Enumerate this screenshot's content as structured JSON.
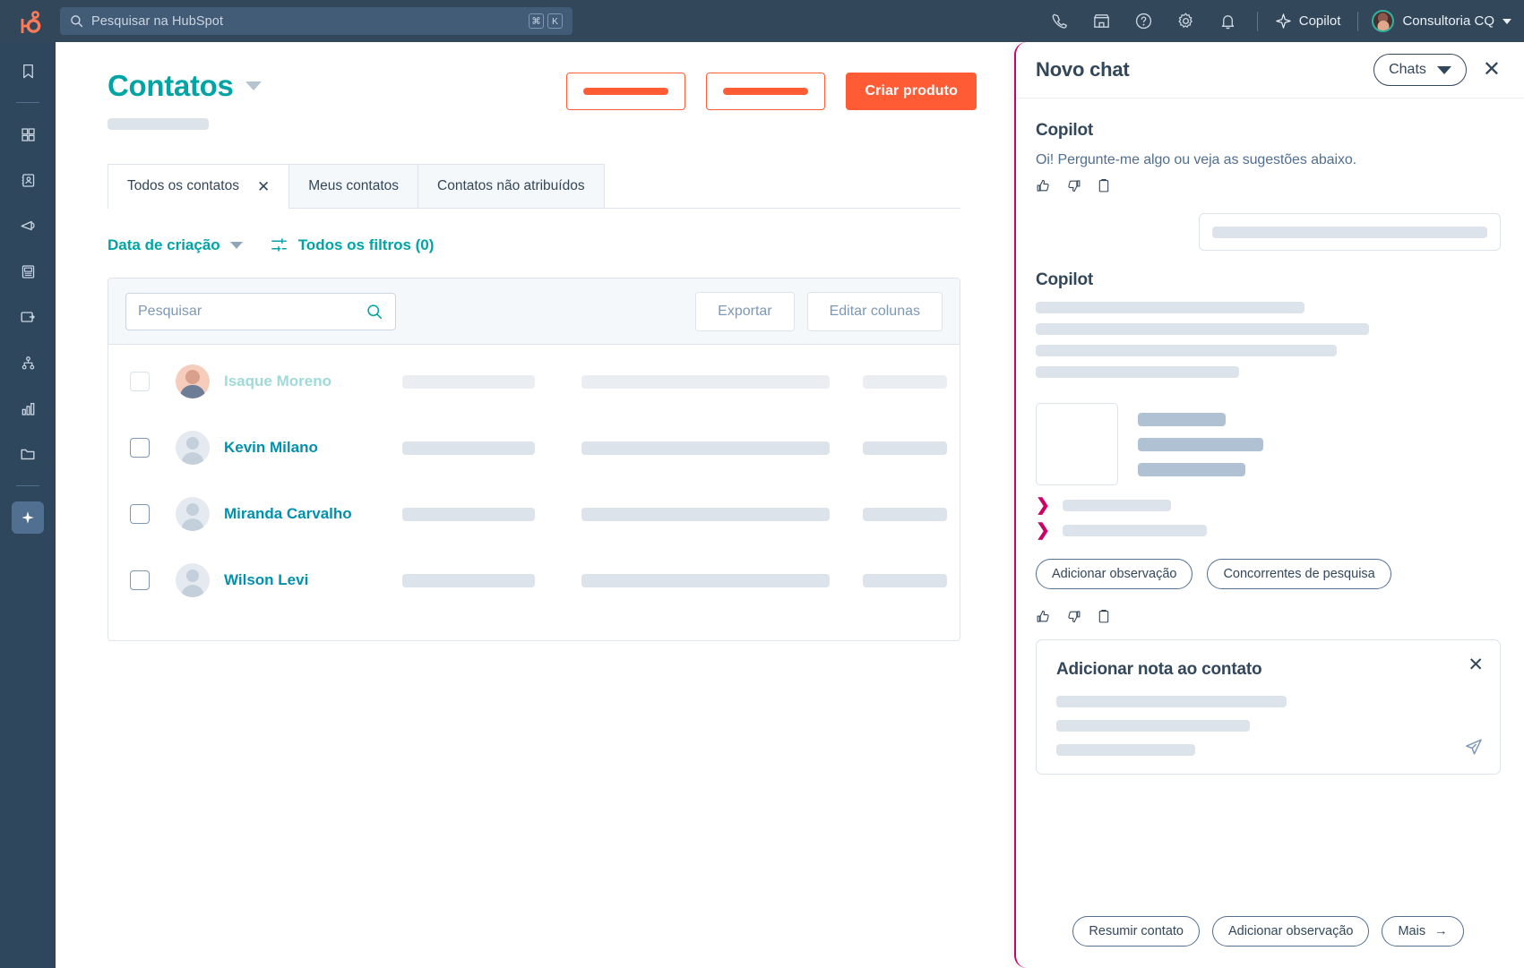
{
  "topnav": {
    "logo": "hubspot-sprocket-logo",
    "search": {
      "placeholder": "Pesquisar na HubSpot",
      "shortcut_keys": [
        "⌘",
        "K"
      ]
    },
    "icons": [
      "phone-icon",
      "marketplace-icon",
      "help-circle-icon",
      "gear-icon",
      "bell-icon"
    ],
    "copilot_label": "Copilot",
    "account_name": "Consultoria CQ"
  },
  "rail": {
    "items": [
      {
        "name": "bookmark-icon"
      },
      {
        "name": "grid-apps-icon"
      },
      {
        "name": "contacts-card-icon"
      },
      {
        "name": "megaphone-icon"
      },
      {
        "name": "content-page-icon"
      },
      {
        "name": "commerce-wallet-icon"
      },
      {
        "name": "automation-nodes-icon"
      },
      {
        "name": "reports-bars-icon"
      },
      {
        "name": "library-folder-icon"
      },
      {
        "name": "copilot-sparkle-icon"
      }
    ]
  },
  "main": {
    "title": "Contatos",
    "header_buttons": [
      {
        "label": "",
        "style": "outline-placeholder"
      },
      {
        "label": "",
        "style": "outline-placeholder"
      },
      {
        "label": "Criar produto",
        "style": "primary"
      }
    ],
    "tabs": [
      {
        "label": "Todos os contatos",
        "active": true,
        "closable": true
      },
      {
        "label": "Meus contatos",
        "active": false,
        "closable": false
      },
      {
        "label": "Contatos não atribuídos",
        "active": false,
        "closable": false
      }
    ],
    "filters": {
      "date_label": "Data de criação",
      "all_filters_label": "Todos os filtros (0)"
    },
    "table": {
      "search_placeholder": "Pesquisar",
      "export_label": "Exportar",
      "edit_columns_label": "Editar colunas",
      "rows": [
        {
          "name": "Isaque Moreno",
          "faded": true,
          "avatar": "photo"
        },
        {
          "name": "Kevin Milano",
          "faded": false,
          "avatar": "default"
        },
        {
          "name": "Miranda Carvalho",
          "faded": false,
          "avatar": "default"
        },
        {
          "name": "Wilson Levi",
          "faded": false,
          "avatar": "default"
        }
      ]
    }
  },
  "copilot": {
    "panel_title": "Novo chat",
    "chats_label": "Chats",
    "assistant_name_1": "Copilot",
    "greeting": "Oi! Pergunte-me algo ou veja as sugestões abaixo.",
    "assistant_name_2": "Copilot",
    "suggestion_chips": [
      "Adicionar observação",
      "Concorrentes de pesquisa"
    ],
    "note_card": {
      "title": "Adicionar nota ao contato"
    },
    "footer_chips": [
      "Resumir contato",
      "Adicionar observação",
      "Mais"
    ],
    "accent_color": "#cc0066"
  },
  "colors": {
    "nav_bg": "#33475b",
    "rail_bg": "#2e475d",
    "teal": "#00a4a4",
    "orange": "#ff5c35",
    "link_blue": "#0091ae",
    "magenta": "#cc0066"
  }
}
